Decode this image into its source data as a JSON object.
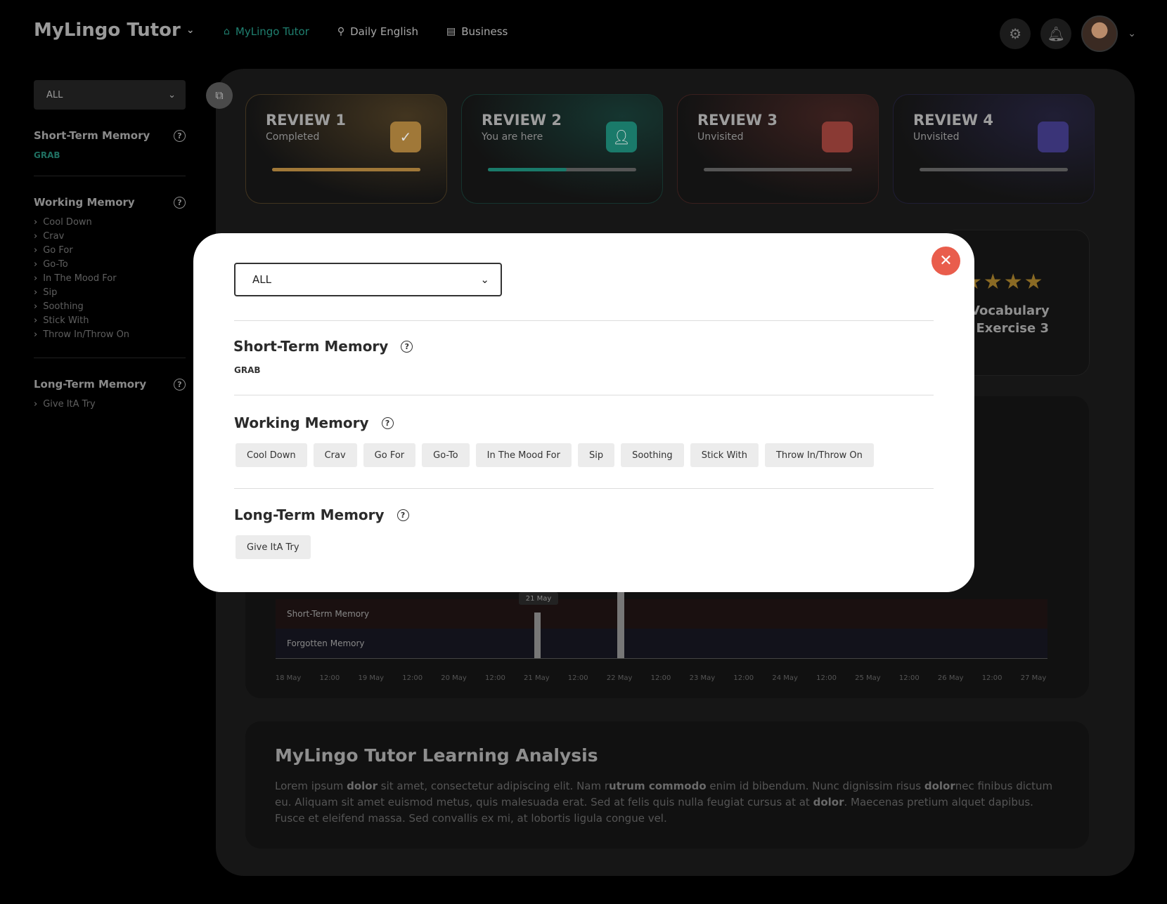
{
  "header": {
    "brand": "MyLingo Tutor",
    "nav": [
      {
        "label": "MyLingo Tutor",
        "icon": "home-icon"
      },
      {
        "label": "Daily English",
        "icon": "location-pin-icon"
      },
      {
        "label": "Business",
        "icon": "building-icon"
      }
    ]
  },
  "sidebar": {
    "filter_value": "ALL",
    "short_term": {
      "title": "Short-Term Memory",
      "tag": "GRAB"
    },
    "working": {
      "title": "Working Memory",
      "items": [
        "Cool Down",
        "Crav",
        "Go For",
        "Go-To",
        "In The Mood For",
        "Sip",
        "Soothing",
        "Stick With",
        "Throw In/Throw On"
      ]
    },
    "long_term": {
      "title": "Long-Term Memory",
      "items": [
        "Give ItA Try"
      ]
    }
  },
  "reviews": [
    {
      "title": "REVIEW 1",
      "status": "Completed",
      "progress": 1.0,
      "color": "#a07838",
      "badge_icon": "check-icon"
    },
    {
      "title": "REVIEW 2",
      "status": "You are here",
      "progress": 0.53,
      "color": "#1a7a6a",
      "badge_icon": "user-icon"
    },
    {
      "title": "REVIEW 3",
      "status": "Unvisited",
      "progress": 0,
      "color": "#8a3a34",
      "badge_icon": ""
    },
    {
      "title": "REVIEW 4",
      "status": "Unvisited",
      "progress": 0,
      "color": "#3a3478",
      "badge_icon": ""
    }
  ],
  "exercise_card": {
    "line1": "Vocabulary",
    "line2": "Exercise 3",
    "stars": "★★★★"
  },
  "chart": {
    "bands": [
      "Short-Term Memory",
      "Forgotten Memory"
    ],
    "marker_label": "21 May",
    "x_ticks": [
      "18 May",
      "12:00",
      "19 May",
      "12:00",
      "20 May",
      "12:00",
      "21 May",
      "12:00",
      "22 May",
      "12:00",
      "23 May",
      "12:00",
      "24 May",
      "12:00",
      "25 May",
      "12:00",
      "26 May",
      "12:00",
      "27 May"
    ]
  },
  "analysis": {
    "title": "MyLingo Tutor Learning Analysis",
    "p1": "Lorem ipsum ",
    "b1": "dolor",
    "p2": " sit amet, consectetur adipiscing elit. Nam r",
    "b2": "utrum commodo",
    "p3": " enim id bibendum. Nunc dignissim risus ",
    "b3": "dolor",
    "p4": "nec finibus dictum eu. Aliquam sit amet euismod metus, quis malesuada erat. Sed at felis quis nulla feugiat cursus at at ",
    "b4": "dolor",
    "p5": ". Maecenas pretium alquet dapibus. Fusce et eleifend massa.  Sed convallis ex mi, at lobortis ligula congue vel."
  },
  "modal": {
    "filter_value": "ALL",
    "short_term": {
      "title": "Short-Term Memory",
      "tag": "GRAB"
    },
    "working": {
      "title": "Working Memory",
      "chips": [
        "Cool Down",
        "Crav",
        "Go For",
        "Go-To",
        "In The Mood For",
        "Sip",
        "Soothing",
        "Stick With",
        "Throw In/Throw On"
      ]
    },
    "long_term": {
      "title": "Long-Term Memory",
      "chips": [
        "Give ItA Try"
      ]
    }
  }
}
